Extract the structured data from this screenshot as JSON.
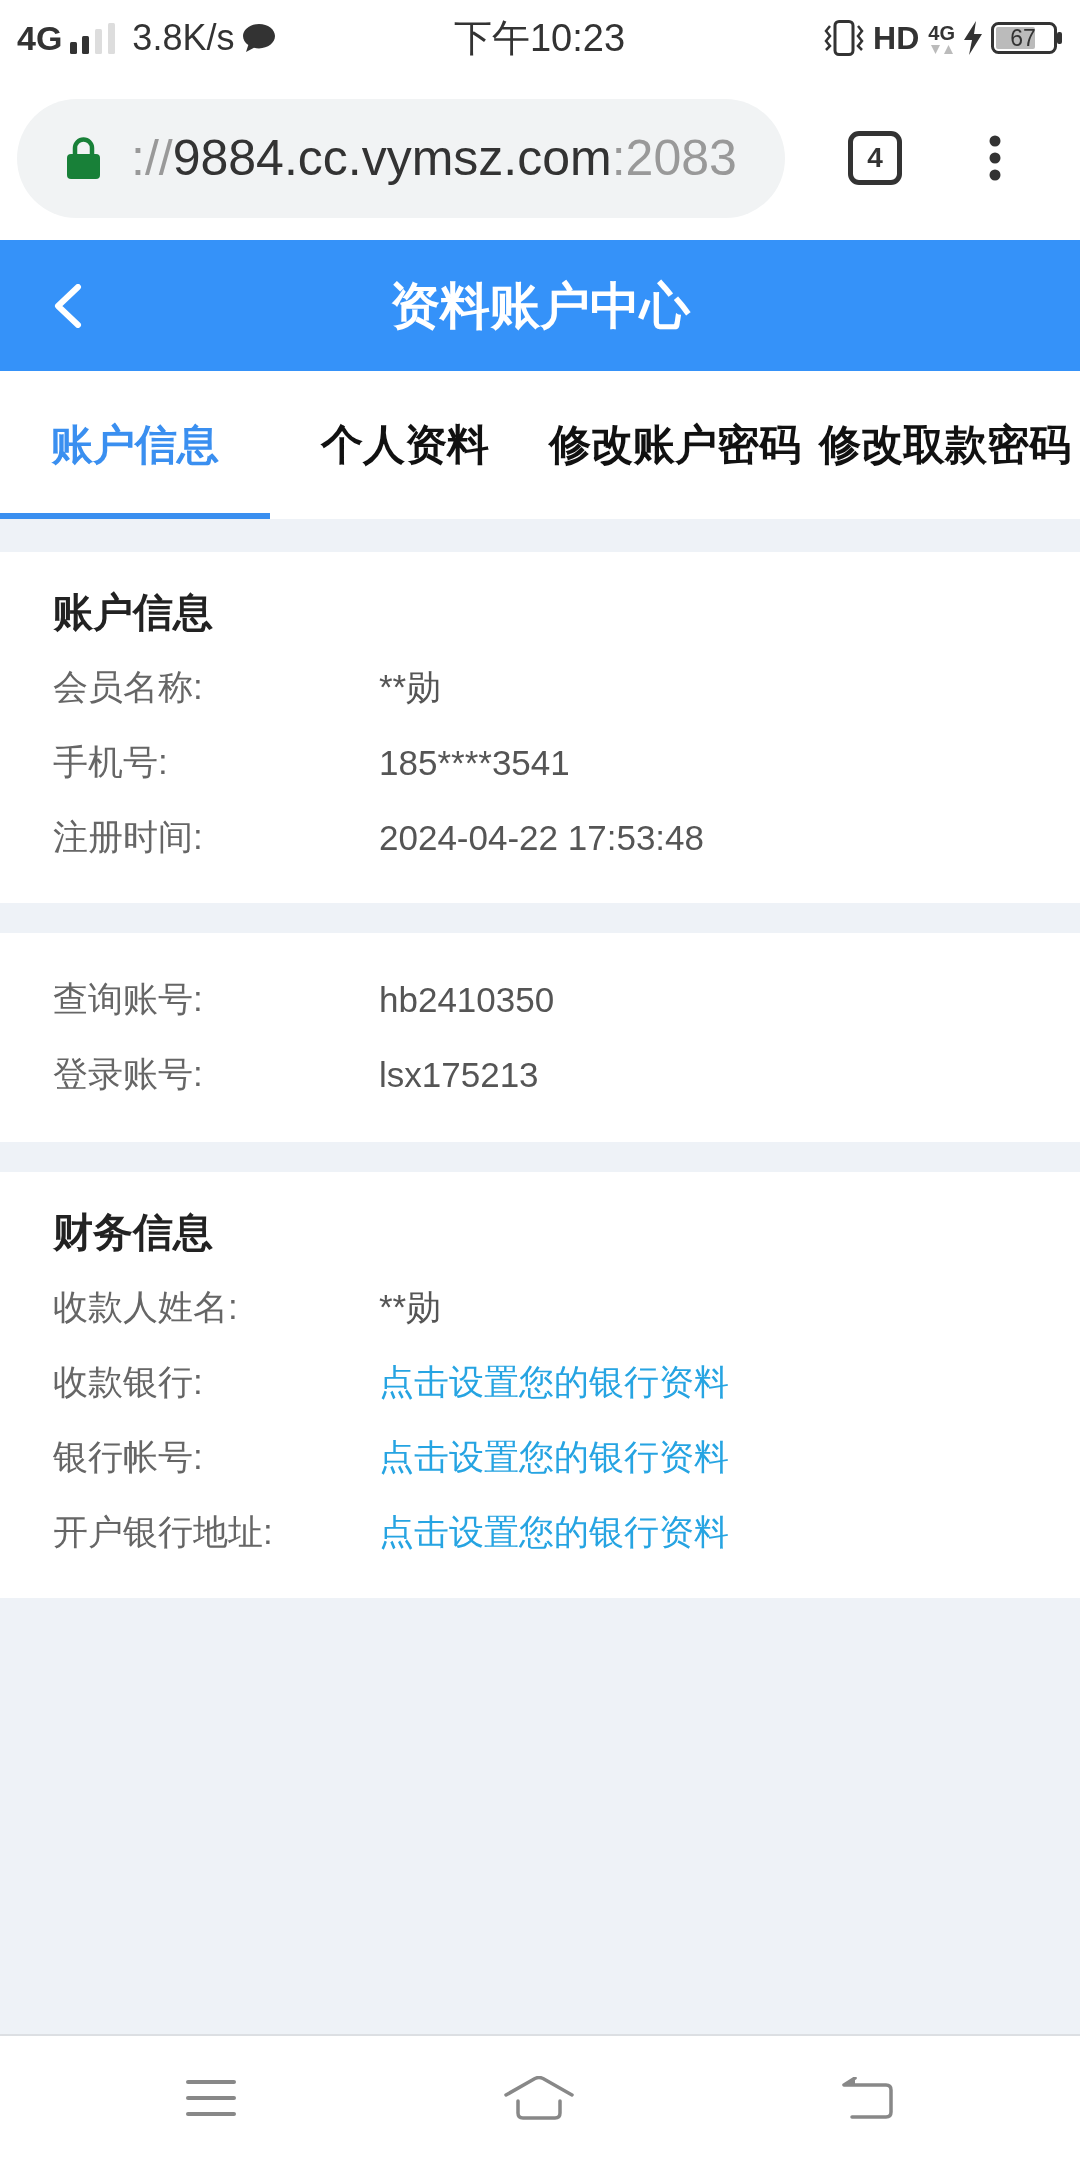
{
  "status_bar": {
    "network": "4G",
    "speed": "3.8K/s",
    "time": "下午10:23",
    "hd": "HD",
    "data_type": "4G",
    "battery": "67"
  },
  "browser": {
    "url": {
      "prefix": "://",
      "host": "9884.cc.vymsz.com",
      "port": ":2083"
    },
    "tab_count": "4"
  },
  "header": {
    "title": "资料账户中心"
  },
  "tabs": [
    {
      "label": "账户信息",
      "selected": true
    },
    {
      "label": "个人资料",
      "selected": false
    },
    {
      "label": "修改账户密码",
      "selected": false
    },
    {
      "label": "修改取款密码",
      "selected": false
    }
  ],
  "sections": [
    {
      "heading": "账户信息",
      "rows": [
        {
          "label": "会员名称:",
          "value": "**勋",
          "kind": "text"
        },
        {
          "label": "手机号:",
          "value": "185****3541",
          "kind": "text"
        },
        {
          "label": "注册时间:",
          "value": "2024-04-22 17:53:48",
          "kind": "text"
        }
      ]
    },
    {
      "rows": [
        {
          "label": "查询账号:",
          "value": "hb2410350",
          "kind": "text"
        },
        {
          "label": "登录账号:",
          "value": "lsx175213",
          "kind": "text"
        }
      ]
    },
    {
      "heading": "财务信息",
      "rows": [
        {
          "label": "收款人姓名:",
          "value": "**勋",
          "kind": "text"
        },
        {
          "label": "收款银行:",
          "value": "点击设置您的银行资料",
          "kind": "link"
        },
        {
          "label": "银行帐号:",
          "value": "点击设置您的银行资料",
          "kind": "link"
        },
        {
          "label": "开户银行地址:",
          "value": "点击设置您的银行资料",
          "kind": "link"
        }
      ]
    }
  ]
}
